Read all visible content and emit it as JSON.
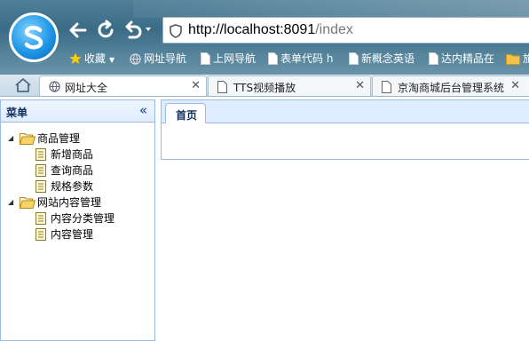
{
  "browser": {
    "address": {
      "host": "http://localhost:8091",
      "path": "/index"
    },
    "bookmarks": [
      {
        "label": "收藏",
        "icon": "star-icon"
      },
      {
        "label": "网址导航",
        "icon": "globe-icon"
      },
      {
        "label": "上网导航",
        "icon": "page-icon"
      },
      {
        "label": "表单代码 h",
        "icon": "page-icon"
      },
      {
        "label": "新概念英语",
        "icon": "page-icon"
      },
      {
        "label": "达内精品在",
        "icon": "page-icon"
      },
      {
        "label": "旅",
        "icon": "folder-icon"
      }
    ],
    "tabs": [
      {
        "label": "网址大全",
        "icon": "globe-icon",
        "active": true
      },
      {
        "label": "TTS视频播放",
        "icon": "page-icon",
        "active": false
      },
      {
        "label": "京淘商城后台管理系统",
        "icon": "page-icon",
        "active": false
      }
    ],
    "colors": {
      "chrome_top": "#3b6c86",
      "tab_bar": "#dbe7f0",
      "logo": "#1f96e6"
    }
  },
  "sidebar": {
    "title": "菜单",
    "collapse_glyph": "«",
    "groups": [
      {
        "label": "商品管理",
        "items": [
          "新增商品",
          "查询商品",
          "规格参数"
        ]
      },
      {
        "label": "网站内容管理",
        "items": [
          "内容分类管理",
          "内容管理"
        ]
      }
    ]
  },
  "main": {
    "tabs": [
      {
        "label": "首页"
      }
    ]
  },
  "theme": {
    "panel_border": "#99bbe8",
    "header_bg": "#e0ecff",
    "header_text": "#0e2d5f"
  }
}
